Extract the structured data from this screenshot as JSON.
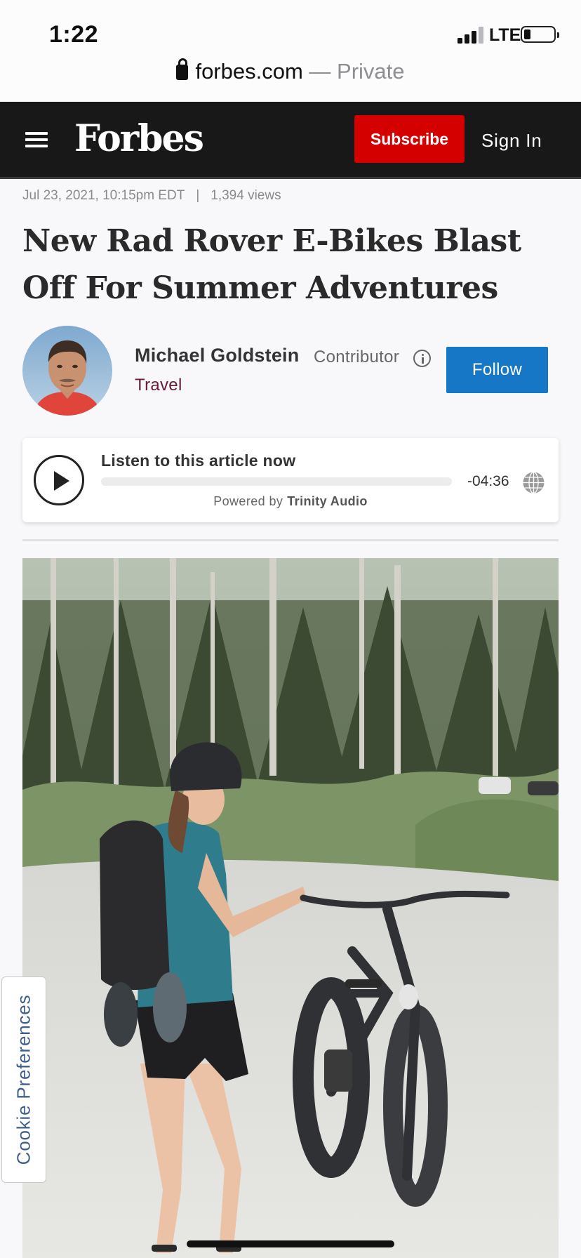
{
  "status_bar": {
    "time": "1:22",
    "network": "LTE",
    "signal_bars": 3,
    "battery_level": 0.15
  },
  "browser": {
    "domain": "forbes.com",
    "privacy": "— Private",
    "icon": "lock-icon"
  },
  "header": {
    "logo": "Forbes",
    "menu_icon": "hamburger-icon",
    "subscribe_label": "Subscribe",
    "signin_label": "Sign In",
    "subscribe_color": "#d40000",
    "bar_color": "#181818"
  },
  "article": {
    "date": "Jul 23, 2021, 10:15pm EDT",
    "separator": "|",
    "views": "1,394 views",
    "title": "New Rad Rover E-Bikes Blast Off For Summer Adventures"
  },
  "author": {
    "name": "Michael Goldstein",
    "role": "Contributor",
    "channel": "Travel",
    "follow_label": "Follow",
    "follow_color": "#1577c5",
    "channel_color": "#6b1a3a"
  },
  "audio": {
    "title": "Listen to this article now",
    "time_remaining": "-04:36",
    "progress": 0,
    "powered_by": "Powered by",
    "provider": "Trinity Audio"
  },
  "cookie": {
    "label": "Cookie Preferences"
  }
}
